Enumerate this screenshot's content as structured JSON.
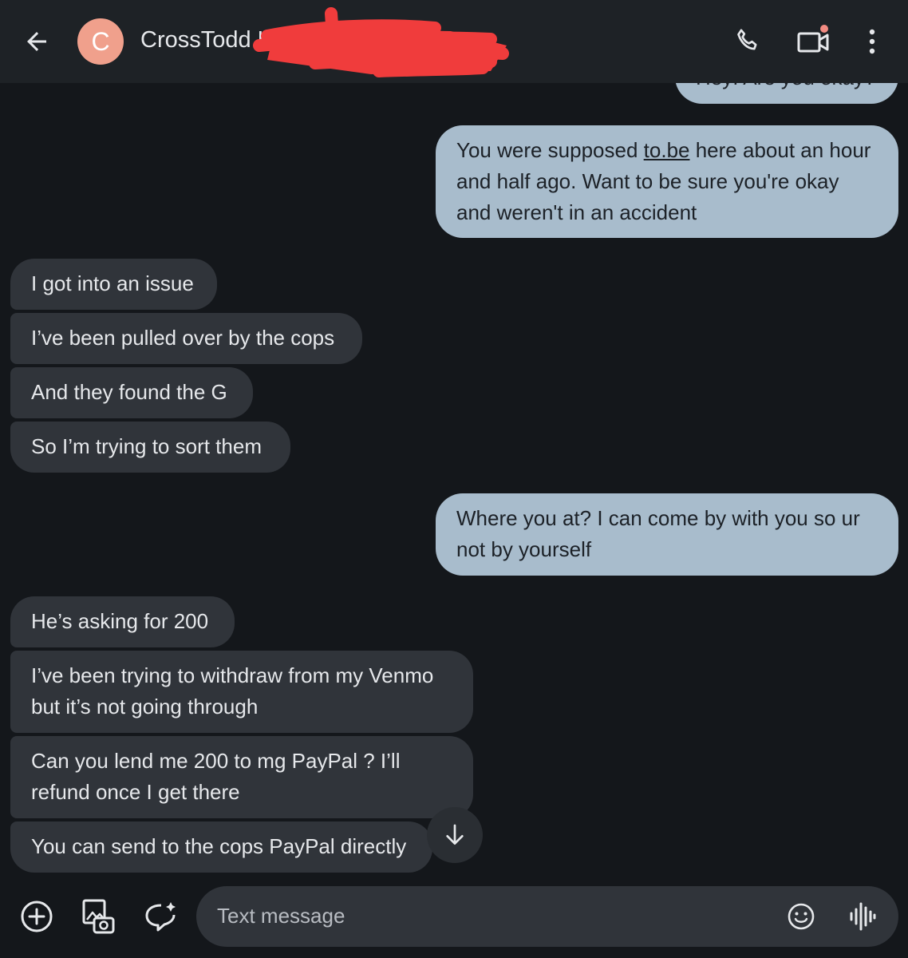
{
  "header": {
    "avatar_letter": "C",
    "contact_name": "CrossTodd L"
  },
  "messages": [
    {
      "side": "out",
      "text_partial": "Hey!  Are you okay?"
    },
    {
      "side": "out",
      "text_before": "You were supposed ",
      "link": "to.be",
      "text_after": " here about an hour and half ago. Want to be sure you're okay and weren't in an accident"
    },
    {
      "side": "in",
      "text": "I got into an issue"
    },
    {
      "side": "in",
      "text": "I’ve been pulled over by the cops"
    },
    {
      "side": "in",
      "text": "And they found the G"
    },
    {
      "side": "in",
      "text": "So I’m trying to sort them"
    },
    {
      "side": "out",
      "text": "Where  you at? I can come by with you so ur not by yourself"
    },
    {
      "side": "in",
      "text": "He’s asking for 200"
    },
    {
      "side": "in",
      "text": "I’ve been trying to withdraw from my Venmo but it’s not going through"
    },
    {
      "side": "in",
      "text": "Can you lend me 200 to mg PayPal ? I’ll refund once I get there"
    },
    {
      "side": "in",
      "text": "You can send to the cops PayPal directly"
    }
  ],
  "composer": {
    "placeholder": "Text message"
  },
  "icons": [
    "back-arrow-icon",
    "phone-icon",
    "video-call-icon",
    "more-vert-icon",
    "arrow-down-icon",
    "add-circle-icon",
    "gallery-icon",
    "sticker-icon",
    "emoji-icon",
    "voice-waveform-icon"
  ],
  "colors": {
    "background": "#14171b",
    "header": "#1e2226",
    "incoming_bubble": "#30343a",
    "outgoing_bubble": "#a8bccc",
    "avatar": "#f0a08c",
    "notification_dot": "#f28b82",
    "redaction": "#f03c3c"
  }
}
